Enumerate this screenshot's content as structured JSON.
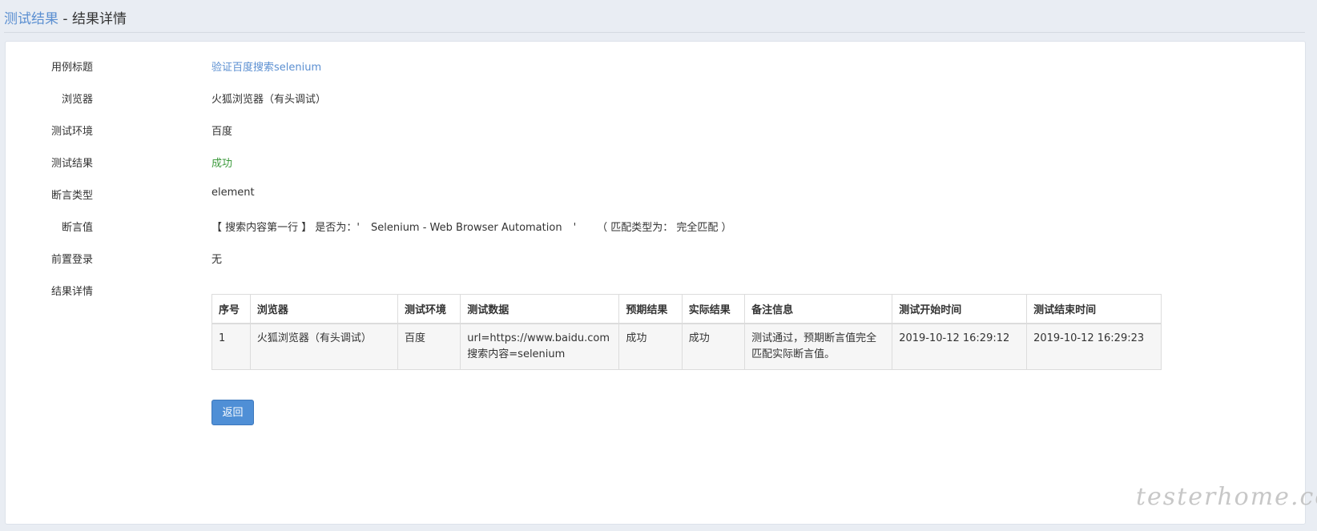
{
  "header": {
    "crumb_link": "测试结果",
    "separator": " - ",
    "current": "结果详情"
  },
  "fields": {
    "case_title_label": "用例标题",
    "case_title_value": "验证百度搜索selenium",
    "browser_label": "浏览器",
    "browser_value": "火狐浏览器（有头调试）",
    "env_label": "测试环境",
    "env_value": "百度",
    "result_label": "测试结果",
    "result_value": "成功",
    "assert_type_label": "断言类型",
    "assert_type_value": "element",
    "assert_value_label": "断言值",
    "assert_value_part1": "【 搜索内容第一行 】 是否为：'",
    "assert_value_part2": "Selenium - Web Browser Automation",
    "assert_value_part3": "'",
    "assert_value_part4": "（ 匹配类型为： 完全匹配 ）",
    "pre_login_label": "前置登录",
    "pre_login_value": "无",
    "detail_label": "结果详情"
  },
  "table": {
    "headers": [
      "序号",
      "浏览器",
      "测试环境",
      "测试数据",
      "预期结果",
      "实际结果",
      "备注信息",
      "测试开始时间",
      "测试结束时间"
    ],
    "rows": [
      {
        "index": "1",
        "browser": "火狐浏览器（有头调试）",
        "env": "百度",
        "data_line1": "url=https://www.baidu.com",
        "data_line2": "搜索内容=selenium",
        "expected": "成功",
        "actual": "成功",
        "note": "测试通过，预期断言值完全匹配实际断言值。",
        "start_time": "2019-10-12 16:29:12",
        "end_time": "2019-10-12 16:29:23"
      }
    ]
  },
  "buttons": {
    "back": "返回"
  },
  "watermark": "testerhome.com",
  "colors": {
    "link": "#5b8fd1",
    "success": "#3c9a3c",
    "button": "#4f8fd6",
    "background": "#e9edf3"
  }
}
